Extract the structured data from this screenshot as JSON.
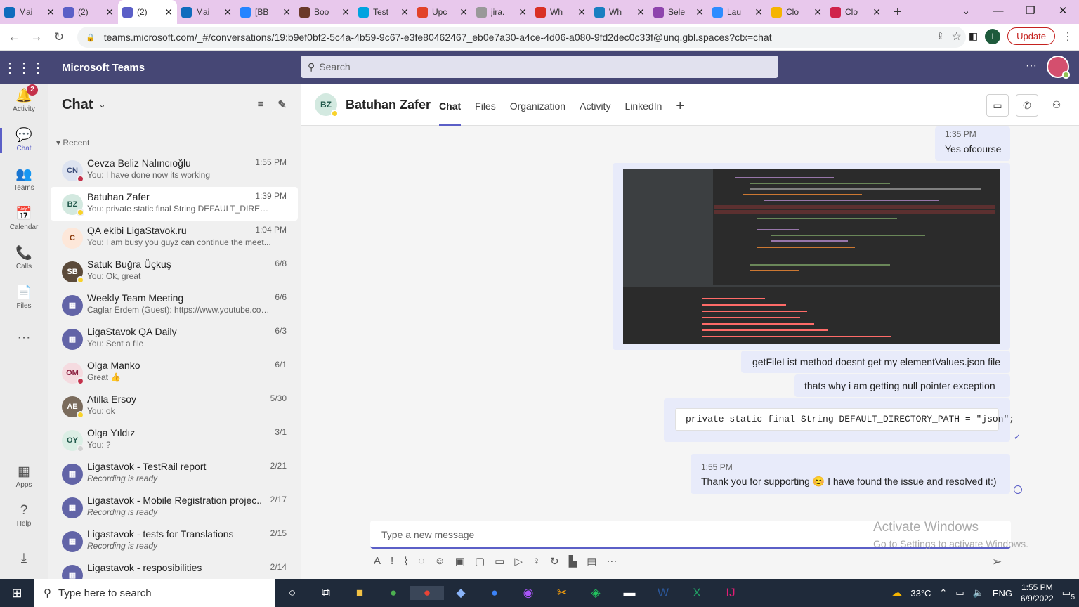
{
  "browser": {
    "tabs": [
      {
        "title": "Mai",
        "color": "#0f6cbd"
      },
      {
        "title": "(2) ",
        "color": "#5b5fc7"
      },
      {
        "title": "(2) ",
        "color": "#5b5fc7",
        "active": true
      },
      {
        "title": "Mai",
        "color": "#0f6cbd"
      },
      {
        "title": "[BB",
        "color": "#2684ff"
      },
      {
        "title": "Boo",
        "color": "#6b3a2a"
      },
      {
        "title": "Test",
        "color": "#00a3e0"
      },
      {
        "title": "Upc",
        "color": "#e24329"
      },
      {
        "title": "jira.",
        "color": "#999999"
      },
      {
        "title": "Wh",
        "color": "#d93025"
      },
      {
        "title": "Wh",
        "color": "#1a7fc1"
      },
      {
        "title": "Sele",
        "color": "#8e44ad"
      },
      {
        "title": "Lau",
        "color": "#2d8cff"
      },
      {
        "title": "Clo",
        "color": "#f5b400"
      },
      {
        "title": "Clo",
        "color": "#d0224b"
      }
    ],
    "url": "teams.microsoft.com/_#/conversations/19:b9ef0bf2-5c4a-4b59-9c67-e3fe80462467_eb0e7a30-a4ce-4d06-a080-9fd2dec0c33f@unq.gbl.spaces?ctx=chat",
    "profile_initial": "I",
    "update_label": "Update"
  },
  "teams": {
    "brand": "Microsoft Teams",
    "search_placeholder": "Search",
    "more": "···"
  },
  "rail": [
    {
      "label": "Activity",
      "icon": "bell-icon",
      "glyph": "🔔",
      "badge": "2"
    },
    {
      "label": "Chat",
      "icon": "chat-icon",
      "glyph": "💬",
      "active": true
    },
    {
      "label": "Teams",
      "icon": "teams-icon",
      "glyph": "👥"
    },
    {
      "label": "Calendar",
      "icon": "calendar-icon",
      "glyph": "📅"
    },
    {
      "label": "Calls",
      "icon": "phone-icon",
      "glyph": "📞"
    },
    {
      "label": "Files",
      "icon": "file-icon",
      "glyph": "📄"
    },
    {
      "label": "",
      "icon": "more-icon",
      "glyph": "···"
    },
    {
      "label": "Apps",
      "icon": "apps-icon",
      "glyph": "▦"
    },
    {
      "label": "Help",
      "icon": "help-icon",
      "glyph": "?"
    }
  ],
  "chat_list": {
    "title": "Chat",
    "section": "Recent",
    "items": [
      {
        "initials": "CN",
        "name": "Cevza Beliz Nalıncıoğlu",
        "preview": "You: I have done now its working",
        "time": "1:55 PM",
        "avatar_bg": "#dde3f0",
        "avatar_fg": "#3c4d7a",
        "status": "#c4314b"
      },
      {
        "initials": "BZ",
        "name": "Batuhan Zafer",
        "preview": "You: private static final String DEFAULT_DIRECT...",
        "time": "1:39 PM",
        "avatar_bg": "#d3e9e0",
        "avatar_fg": "#20574a",
        "status": "#f8d22a",
        "selected": true
      },
      {
        "initials": "C",
        "name": "QA ekibi LigaStavok.ru",
        "preview": "You: I am busy you guyz can continue the meet...",
        "time": "1:04 PM",
        "avatar_bg": "#fde7d9",
        "avatar_fg": "#8a3707"
      },
      {
        "initials": "SB",
        "name": "Satuk Buğra Üçkuş",
        "preview": "You: Ok, great",
        "time": "6/8",
        "avatar_bg": "#5b4a3a",
        "avatar_fg": "#ffffff",
        "status": "#f8d22a"
      },
      {
        "initials": "▦",
        "name": "Weekly Team Meeting",
        "preview": "Caglar Erdem (Guest): https://www.youtube.com/...",
        "time": "6/6",
        "avatar_bg": "#6264a7",
        "avatar_fg": "#ffffff"
      },
      {
        "initials": "▦",
        "name": "LigaStavok QA Daily",
        "preview": "You: Sent a file",
        "time": "6/3",
        "avatar_bg": "#6264a7",
        "avatar_fg": "#ffffff"
      },
      {
        "initials": "OM",
        "name": "Olga Manko",
        "preview": "Great 👍",
        "time": "6/1",
        "avatar_bg": "#f5dbe0",
        "avatar_fg": "#8b2040",
        "status": "#c4314b"
      },
      {
        "initials": "AE",
        "name": "Atilla Ersoy",
        "preview": "You: ok",
        "time": "5/30",
        "avatar_bg": "#7a6b5c",
        "avatar_fg": "#ffffff",
        "status": "#f8d22a"
      },
      {
        "initials": "OY",
        "name": "Olga Yıldız",
        "preview": "You: ?",
        "time": "3/1",
        "avatar_bg": "#dbeee5",
        "avatar_fg": "#20574a",
        "status": "#d1d1d1"
      },
      {
        "initials": "▦",
        "name": "Ligastavok - TestRail report",
        "preview": "Recording is ready",
        "time": "2/21",
        "avatar_bg": "#6264a7",
        "avatar_fg": "#ffffff",
        "italic": true
      },
      {
        "initials": "▦",
        "name": "Ligastavok - Mobile Registration projec...",
        "preview": "Recording is ready",
        "time": "2/17",
        "avatar_bg": "#6264a7",
        "avatar_fg": "#ffffff",
        "italic": true
      },
      {
        "initials": "▦",
        "name": "Ligastavok - tests for Translations",
        "preview": "Recording is ready",
        "time": "2/15",
        "avatar_bg": "#6264a7",
        "avatar_fg": "#ffffff",
        "italic": true
      },
      {
        "initials": "▦",
        "name": "Ligastavok - resposibilities",
        "preview": "",
        "time": "2/14",
        "avatar_bg": "#6264a7",
        "avatar_fg": "#ffffff"
      }
    ]
  },
  "conversation": {
    "initials": "BZ",
    "name": "Batuhan Zafer",
    "tabs": [
      "Chat",
      "Files",
      "Organization",
      "Activity",
      "LinkedIn"
    ],
    "messages": {
      "m1_time": "1:35 PM",
      "m1_text": "Yes ofcourse",
      "m2_text": "getFileList method doesnt get my elementValues.json file",
      "m3_text": "thats why i am getting null pointer exception",
      "m4_code": "private static final String DEFAULT_DIRECTORY_PATH = \"json\";",
      "m5_time": "1:55 PM",
      "m5_text_a": "Thank you for supporting",
      "m5_emoji": "😊",
      "m5_text_b": "I have found the issue and resolved it:)"
    },
    "compose_placeholder": "Type a new message",
    "watermark_1": "Activate Windows",
    "watermark_2": "Go to Settings to activate Windows."
  },
  "taskbar": {
    "search_placeholder": "Type here to search",
    "weather": "33°C",
    "lang": "ENG",
    "time": "1:55 PM",
    "date": "6/9/2022",
    "notif": "5"
  }
}
